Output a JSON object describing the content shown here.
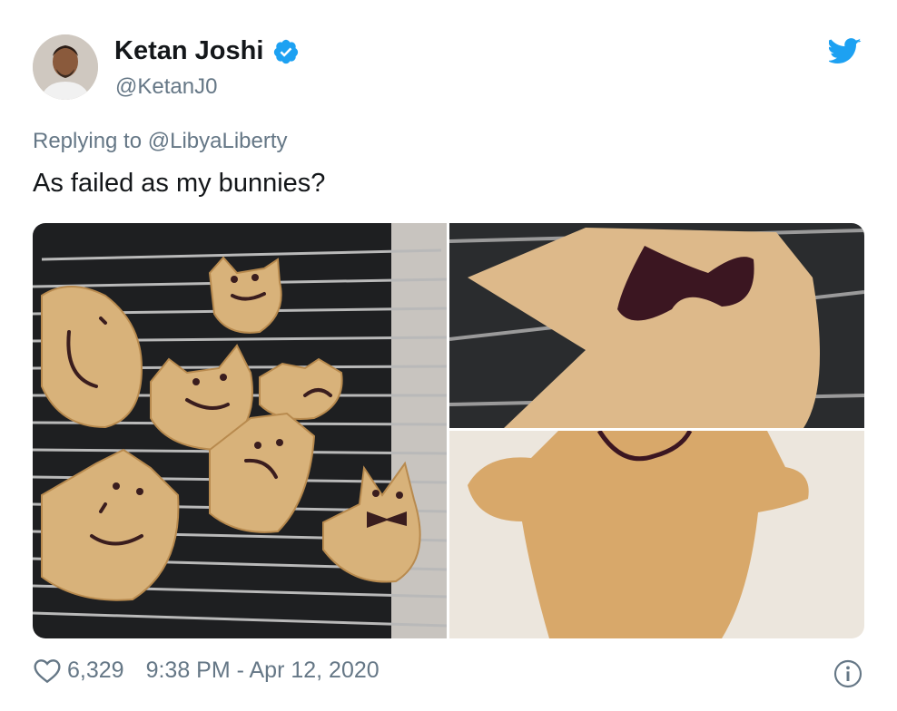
{
  "tweet": {
    "display_name": "Ketan Joshi",
    "handle": "@KetanJ0",
    "reply_prefix": "Replying to",
    "reply_to": "@LibyaLiberty",
    "text": "As failed as my bunnies?",
    "likes": "6,329",
    "timestamp": "9:38 PM - Apr 12, 2020"
  },
  "icons": {
    "verified": "verified-badge-icon",
    "brand": "twitter-bird-icon",
    "like": "heart-icon",
    "info": "info-icon"
  },
  "colors": {
    "brand_blue": "#1da1f2",
    "text_primary": "#14171a",
    "text_secondary": "#657786"
  }
}
